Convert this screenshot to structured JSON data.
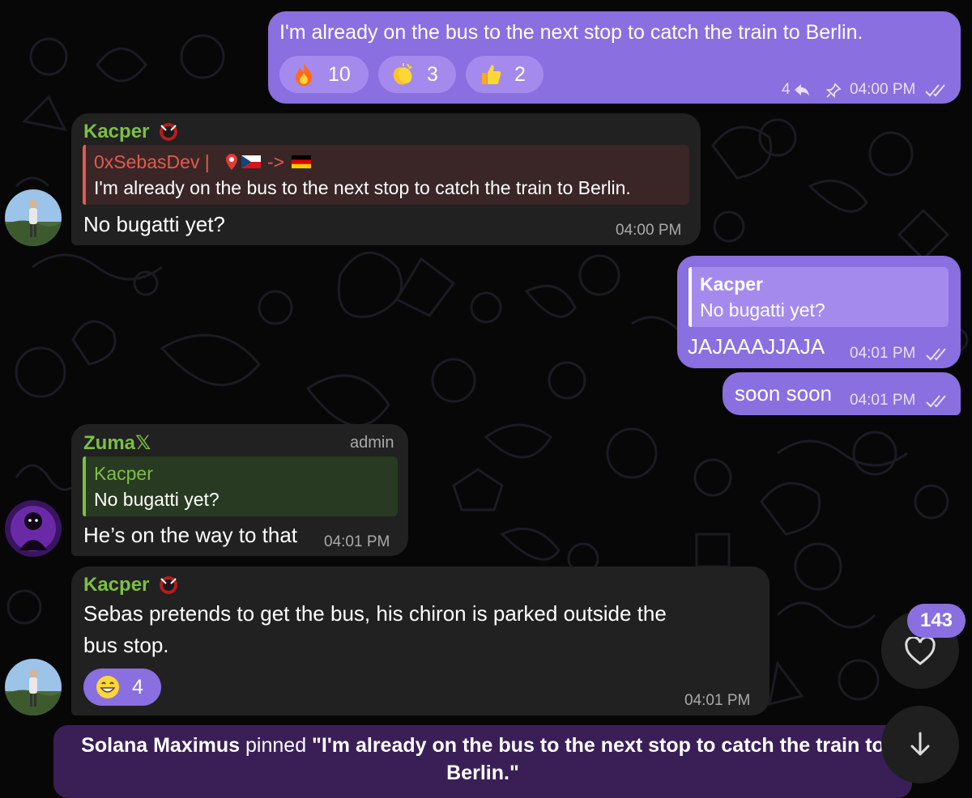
{
  "messages": [
    {
      "id": "m1",
      "text": "I'm already on the bus to the next stop to catch the train to Berlin.",
      "reactions": [
        {
          "emoji": "fire",
          "count": "10"
        },
        {
          "emoji": "clapping-hands",
          "count": "3"
        },
        {
          "emoji": "thumbs-up",
          "count": "2"
        }
      ],
      "replies": "4",
      "time": "04:00 PM"
    },
    {
      "id": "m2",
      "sender": "Kacper",
      "quote": {
        "name": "0xSebasDev |",
        "name_suffix": "->",
        "text": "I'm already on the bus to the next stop to catch the train to Berlin."
      },
      "text": "No bugatti yet?",
      "time": "04:00 PM"
    },
    {
      "id": "m3",
      "quote": {
        "name": "Kacper",
        "text": "No bugatti yet?"
      },
      "text": "JAJAAAJJAJA",
      "time": "04:01 PM"
    },
    {
      "id": "m4",
      "text": "soon soon",
      "time": "04:01 PM"
    },
    {
      "id": "m5",
      "sender": "Zuma𝕏",
      "role": "admin",
      "quote": {
        "name": "Kacper",
        "text": "No bugatti yet?"
      },
      "text": "He’s on the way to that",
      "time": "04:01 PM"
    },
    {
      "id": "m6",
      "sender": "Kacper",
      "text_line1": "Sebas pretends to get the bus, his chiron is parked outside the",
      "text_line2": "bus stop.",
      "reactions": [
        {
          "emoji": "grinning-face",
          "count": "4"
        }
      ],
      "time": "04:01 PM"
    }
  ],
  "floating": {
    "like_count": "143"
  },
  "service_message": {
    "actor": "Solana Maximus",
    "action": " pinned ",
    "pinned_text_line1": "\"I'm already on the bus to the next stop to catch the train to",
    "pinned_text_line2": "Berlin.\""
  },
  "colors": {
    "outgoing_bubble": "#8a6fe0",
    "incoming_bubble": "#212121",
    "sender_name": "#7cc043",
    "quote_red": "#e25a4f",
    "service_bg": "#3a1f57"
  }
}
